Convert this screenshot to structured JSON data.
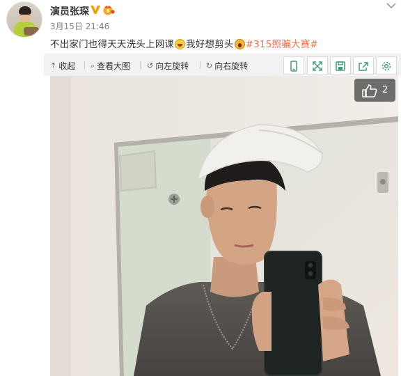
{
  "post": {
    "author": "演员张琛",
    "time": "3月15日 21:46",
    "text_before": "不出家门也得天天洗头上网课",
    "text_middle": "我好想剪头",
    "hashtag": "#315照骗大赛#"
  },
  "toolbar": {
    "collapse": "收起",
    "view_large": "查看大图",
    "rotate_left": "向左旋转",
    "rotate_right": "向右旋转",
    "icons": [
      "phone-icon",
      "fullscreen-icon",
      "save-icon",
      "share-icon",
      "settings-icon"
    ]
  },
  "like": {
    "count": "2"
  },
  "colors": {
    "accent": "#eb7350",
    "verified": "#f2a000",
    "icon_green": "#3d9b7c",
    "toolbar_bg": "#f2f2f5"
  }
}
